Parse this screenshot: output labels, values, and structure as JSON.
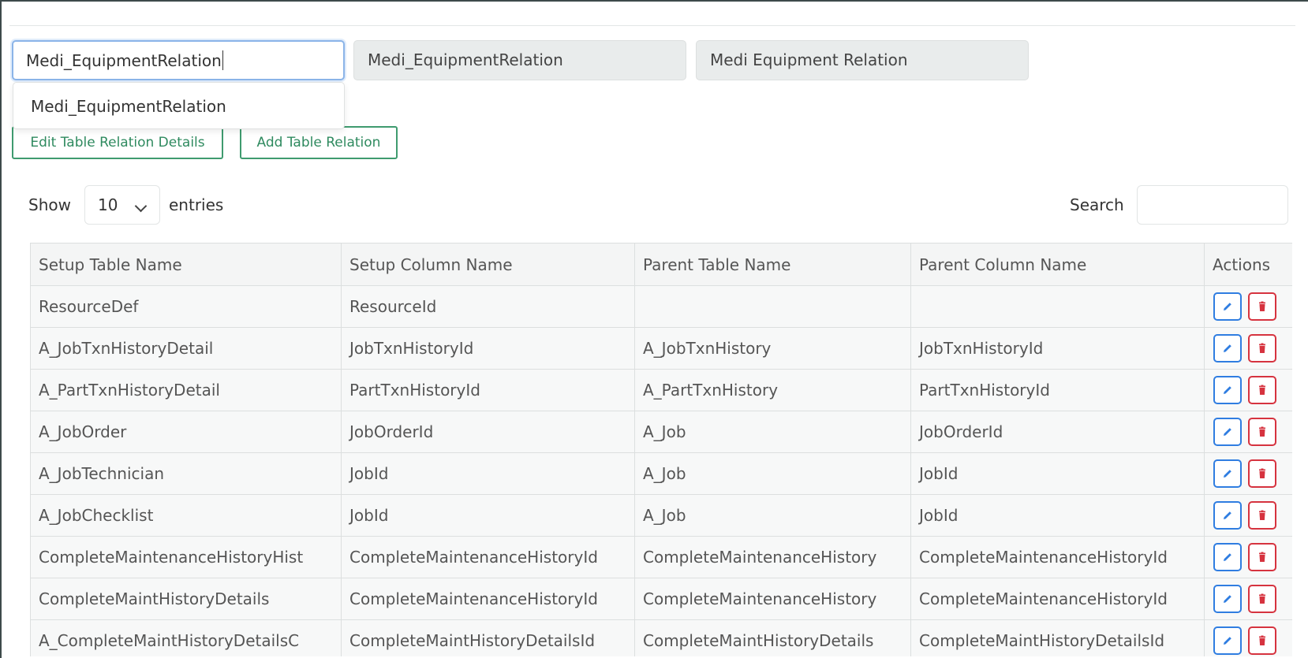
{
  "form": {
    "table_input_value": "Medi_EquipmentRelation",
    "table_name_value": "Medi_EquipmentRelation",
    "display_name_value": "Medi Equipment Relation",
    "suggestion": "Medi_EquipmentRelation"
  },
  "buttons": {
    "edit_details": "Edit Table Relation Details",
    "add_relation": "Add Table Relation"
  },
  "length": {
    "show_label": "Show",
    "value": "10",
    "entries_label": "entries"
  },
  "search": {
    "label": "Search",
    "value": ""
  },
  "table": {
    "headers": [
      "Setup Table Name",
      "Setup Column Name",
      "Parent Table Name",
      "Parent Column Name",
      "Actions"
    ],
    "rows": [
      [
        "ResourceDef",
        "ResourceId",
        "",
        ""
      ],
      [
        "A_JobTxnHistoryDetail",
        "JobTxnHistoryId",
        "A_JobTxnHistory",
        "JobTxnHistoryId"
      ],
      [
        "A_PartTxnHistoryDetail",
        "PartTxnHistoryId",
        "A_PartTxnHistory",
        "PartTxnHistoryId"
      ],
      [
        "A_JobOrder",
        "JobOrderId",
        "A_Job",
        "JobOrderId"
      ],
      [
        "A_JobTechnician",
        "JobId",
        "A_Job",
        "JobId"
      ],
      [
        "A_JobChecklist",
        "JobId",
        "A_Job",
        "JobId"
      ],
      [
        "CompleteMaintenanceHistoryHist",
        "CompleteMaintenanceHistoryId",
        "CompleteMaintenanceHistory",
        "CompleteMaintenanceHistoryId"
      ],
      [
        "CompleteMaintHistoryDetails",
        "CompleteMaintenanceHistoryId",
        "CompleteMaintenanceHistory",
        "CompleteMaintenanceHistoryId"
      ],
      [
        "A_CompleteMaintHistoryDetailsC",
        "CompleteMaintHistoryDetailsId",
        "CompleteMaintHistoryDetails",
        "CompleteMaintHistoryDetailsId"
      ]
    ]
  },
  "colors": {
    "accent_green": "#3f9b6f",
    "edit_blue": "#2f7de1",
    "delete_red": "#d6333f",
    "focus_border": "#8bb4e8"
  },
  "icons": {
    "edit": "pencil-icon",
    "delete": "trash-icon",
    "select": "chevron-down-icon"
  }
}
